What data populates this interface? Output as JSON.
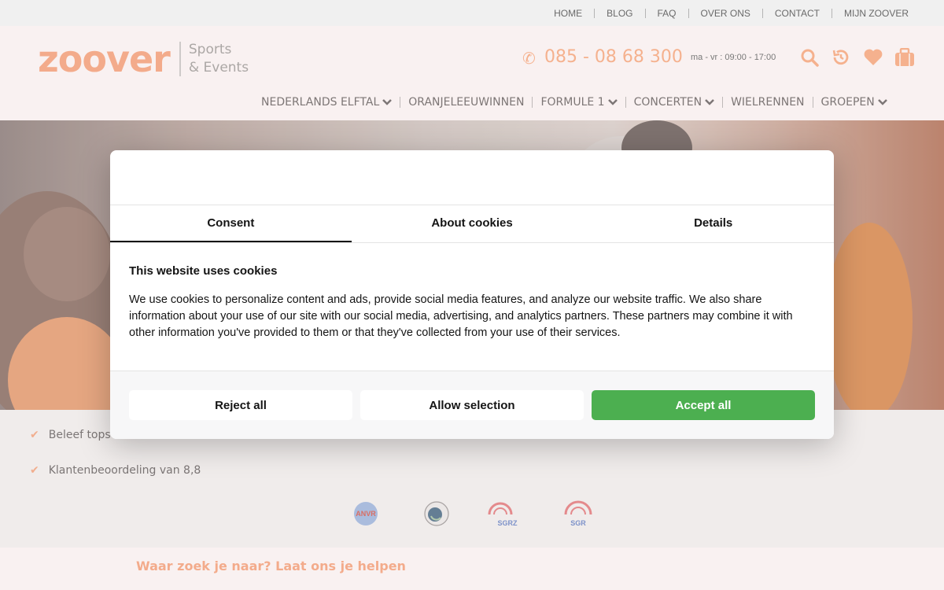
{
  "topnav": {
    "items": [
      "HOME",
      "BLOG",
      "FAQ",
      "OVER ONS",
      "CONTACT",
      "MIJN ZOOVER"
    ]
  },
  "header": {
    "logo_text": "zoover",
    "logo_sub_1": "Sports",
    "logo_sub_2": "& Events",
    "phone": "085 - 08 68 300",
    "hours": "ma - vr : 09:00 - 17:00",
    "icons": [
      "search-icon",
      "history-icon",
      "heart-icon",
      "suitcase-icon"
    ]
  },
  "mainnav": {
    "items": [
      {
        "label": "NEDERLANDS ELFTAL",
        "dropdown": true
      },
      {
        "label": "ORANJELEEUWINNEN",
        "dropdown": false
      },
      {
        "label": "FORMULE 1",
        "dropdown": true
      },
      {
        "label": "CONCERTEN",
        "dropdown": true
      },
      {
        "label": "WIELRENNEN",
        "dropdown": false
      },
      {
        "label": "GROEPEN",
        "dropdown": true
      }
    ]
  },
  "usps": {
    "item_1": "Beleef tops",
    "item_2": "Klantenbeoordeling van 8,8"
  },
  "badges": [
    "ANVR",
    "Calamiteitenfonds",
    "SGRZ",
    "SGR"
  ],
  "helpbar": {
    "text": "Waar zoek je naar? Laat ons je helpen"
  },
  "cookie_dialog": {
    "tabs": [
      "Consent",
      "About cookies",
      "Details"
    ],
    "active_tab": "Consent",
    "title": "This website uses cookies",
    "text": "We use cookies to personalize content and ads, provide social media features, and analyze our website traffic. We also share information about your use of our site with our social media, advertising, and analytics partners. These partners may combine it with other information you've provided to them or that they've collected from your use of their services.",
    "buttons": {
      "reject": "Reject all",
      "selection": "Allow selection",
      "accept": "Accept all"
    }
  },
  "colors": {
    "brand_orange": "#f2a07c",
    "accept_green": "#4caf50"
  }
}
